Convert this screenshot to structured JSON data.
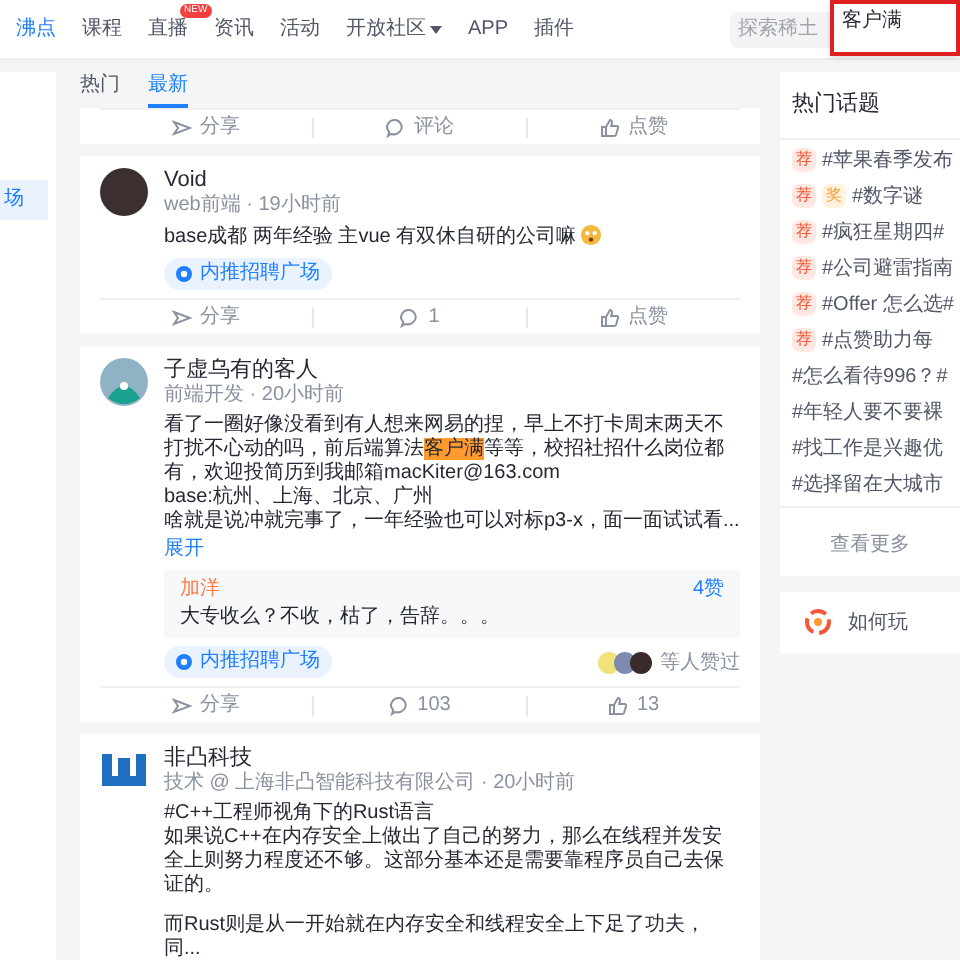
{
  "nav": {
    "items": [
      {
        "label": "沸点",
        "selected": true
      },
      {
        "label": "课程",
        "selected": false
      },
      {
        "label": "直播",
        "selected": false,
        "badge": "NEW"
      },
      {
        "label": "资讯",
        "selected": false
      },
      {
        "label": "活动",
        "selected": false
      },
      {
        "label": "开放社区",
        "selected": false,
        "dropdown": true
      },
      {
        "label": "APP",
        "selected": false
      },
      {
        "label": "插件",
        "selected": false
      }
    ],
    "search": {
      "placeholder": "探索稀土"
    },
    "popup": {
      "value": "客户满"
    }
  },
  "sidebar": {
    "items": [
      {
        "label": "场",
        "selected": true
      }
    ]
  },
  "tabs": [
    {
      "label": "热门",
      "selected": false
    },
    {
      "label": "最新",
      "selected": true
    }
  ],
  "top_actions": {
    "share": "分享",
    "comment": "评论",
    "like": "点赞"
  },
  "posts": [
    {
      "avatar": {
        "kind": "photo"
      },
      "author": "Void",
      "meta": "web前端 · 19小时前",
      "content": [
        {
          "parts": [
            {
              "text": "base成都 两年经验 主vue 有双休自研的公司嘛",
              "highlight": false
            }
          ],
          "emoji": true
        }
      ],
      "tag": "内推招聘广场",
      "actions": {
        "share": "分享",
        "comment": "1",
        "like": "点赞"
      }
    },
    {
      "avatar": {
        "kind": "mascot"
      },
      "author": "子虚乌有的客人",
      "meta": "前端开发 · 20小时前",
      "content": [
        {
          "parts": [
            {
              "text": "看了一圈好像没看到有人想来网易的捏，早上不打卡周末两天不打扰不心动的吗，前后端算法",
              "highlight": false
            },
            {
              "text": "客户满",
              "highlight": true
            },
            {
              "text": "等等，校招社招什么岗位都有，欢迎投简历到我邮箱macKiter@163.com",
              "highlight": false
            }
          ]
        },
        {
          "parts": [
            {
              "text": "base:杭州、上海、北京、广州",
              "highlight": false
            }
          ]
        },
        {
          "parts": [
            {
              "text": "啥就是说冲就完事了，一年经验也可以对标p3-x，面一面试试看...",
              "highlight": false
            }
          ]
        }
      ],
      "expand": "展开",
      "comment": {
        "author": "加洋",
        "likes": "4赞",
        "text": "大专收么？不收，枯了，告辞。。。"
      },
      "tag": "内推招聘广场",
      "likers": "等人赞过",
      "actions": {
        "share": "分享",
        "comment": "103",
        "like": "13"
      }
    },
    {
      "avatar": {
        "kind": "logo"
      },
      "author": "非凸科技",
      "meta": "技术 @ 上海非凸智能科技有限公司 · 20小时前",
      "content": [
        {
          "parts": [
            {
              "text": "#C++工程师视角下的Rust语言",
              "highlight": false
            }
          ]
        },
        {
          "parts": [
            {
              "text": "如果说C++在内存安全上做出了自己的努力，那么在线程并发安全上则努力程度还不够。这部分基本还是需要靠程序员自己去保证的。",
              "highlight": false
            }
          ]
        },
        {
          "gap": true,
          "parts": [
            {
              "text": "而Rust则是从一开始就在内存安全和线程安全上下足了功夫，同...",
              "highlight": false
            }
          ]
        }
      ]
    }
  ],
  "hot_topics": {
    "title": "热门话题",
    "items": [
      {
        "text": "#苹果春季发布",
        "badges": [
          {
            "label": "荐",
            "kind": "recommend"
          }
        ]
      },
      {
        "text": "#数字谜",
        "badges": [
          {
            "label": "荐",
            "kind": "recommend"
          },
          {
            "label": "奖",
            "kind": "prize"
          }
        ]
      },
      {
        "text": "#疯狂星期四#",
        "badges": [
          {
            "label": "荐",
            "kind": "recommend"
          }
        ]
      },
      {
        "text": "#公司避雷指南",
        "badges": [
          {
            "label": "荐",
            "kind": "recommend"
          }
        ]
      },
      {
        "text": "#Offer 怎么选#",
        "badges": [
          {
            "label": "荐",
            "kind": "recommend"
          }
        ]
      },
      {
        "text": "#点赞助力每",
        "badges": [
          {
            "label": "荐",
            "kind": "recommend"
          }
        ]
      },
      {
        "text": "#怎么看待996？#"
      },
      {
        "text": "#年轻人要不要裸"
      },
      {
        "text": "#找工作是兴趣优"
      },
      {
        "text": "#选择留在大城市"
      }
    ],
    "more": "查看更多"
  },
  "promo": {
    "text": "如何玩"
  }
}
